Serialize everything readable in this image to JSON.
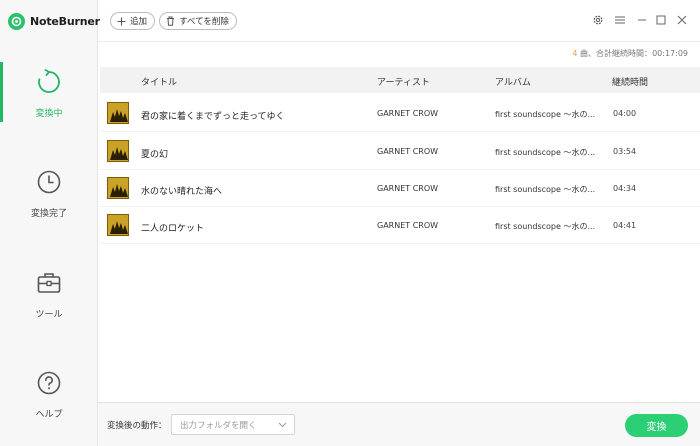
{
  "app": {
    "name": "NoteBurner"
  },
  "sidebar": {
    "items": [
      {
        "label": "変換中",
        "icon": "converting-icon",
        "active": true
      },
      {
        "label": "変換完了",
        "icon": "clock-icon",
        "active": false
      },
      {
        "label": "ツール",
        "icon": "toolbox-icon",
        "active": false
      },
      {
        "label": "ヘルプ",
        "icon": "help-icon",
        "active": false
      }
    ]
  },
  "toolbar": {
    "add_label": "追加",
    "delete_all_label": "すべてを削除"
  },
  "summary": {
    "count": "4",
    "count_unit": " 曲、合計継続時間：",
    "total": "00:17:09"
  },
  "table": {
    "headers": {
      "title": "タイトル",
      "artist": "アーティスト",
      "album": "アルバム",
      "duration": "継続時間"
    },
    "rows": [
      {
        "title": "君の家に着くまでずっと走ってゆく",
        "artist": "GARNET CROW",
        "album": "first soundscope 〜水の...",
        "duration": "04:00"
      },
      {
        "title": "夏の幻",
        "artist": "GARNET CROW",
        "album": "first soundscope 〜水の...",
        "duration": "03:54"
      },
      {
        "title": "水のない晴れた海へ",
        "artist": "GARNET CROW",
        "album": "first soundscope 〜水の...",
        "duration": "04:34"
      },
      {
        "title": "二人のロケット",
        "artist": "GARNET CROW",
        "album": "first soundscope 〜水の...",
        "duration": "04:41"
      }
    ]
  },
  "bottom": {
    "after_label": "変換後の動作：",
    "after_value": "出力フォルダを開く",
    "convert_label": "変換"
  },
  "colors": {
    "accent": "#2bcf74",
    "count": "#e6a23c"
  }
}
